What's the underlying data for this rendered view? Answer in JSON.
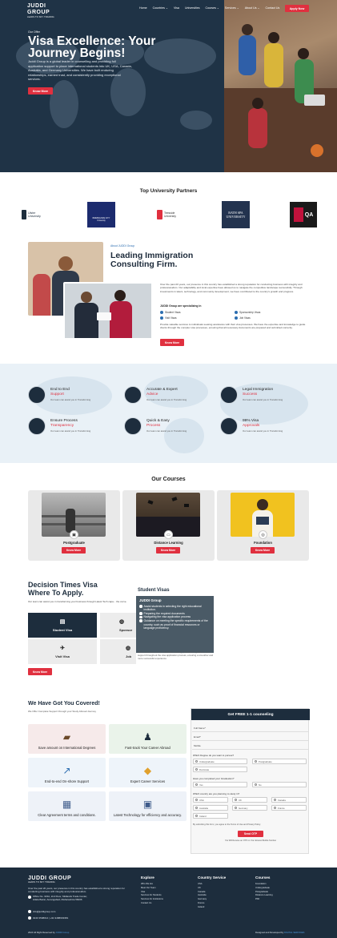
{
  "brand": {
    "name": "JUDDI GROUP",
    "tagline": "LEADS TO SKY TRADING"
  },
  "nav": {
    "items": [
      "Home",
      "Countries",
      "Visa",
      "Universities",
      "Courses",
      "Services",
      "About Us",
      "Contact Us"
    ],
    "apply_label": "Apply Now"
  },
  "hero": {
    "eyebrow": "Our Offer",
    "title": "Visa Excellence: Your Journey Begins!",
    "description": "Juddi Group is a global leader in counselling and providing full application support to place international students into UK, USA, Canada, Australia, and Germany Universities. We have built enduring relationships, earned trust, and consistently providing exceptional services.",
    "button": "Know More"
  },
  "partners": {
    "title": "Top University Partners",
    "logos": [
      {
        "name": "Ulster University",
        "color": "#1d2d3d"
      },
      {
        "name": "BIRMINGHAM CITY University",
        "color": "#1c2b6e"
      },
      {
        "name": "Teesside University",
        "color": "#e0303f"
      },
      {
        "name": "BATH SPA UNIVERSITY",
        "color": "#23334f"
      },
      {
        "name": "QA",
        "color": "#c0123c"
      }
    ]
  },
  "about": {
    "eyebrow": "About JUDDI Group",
    "title": "Leading Immigration Consulting Firm.",
    "p1": "Over the past 20 years, our presence in this country has established a strong reputation for conducting business with integrity and professionalism. Our adaptability and local expertise have allowed us to navigate the competitive landscape successfully. Through investments in talent, technology, and community development, we have contributed to the country's growth and progress.",
    "specializing": "JUDDI Group are specializing in",
    "checks": [
      "Student Visas",
      "Sponsorship Visas",
      "Visit Visas",
      "Job Visas"
    ],
    "p2": "Provide valuable services to individuals seeking assistance with their visa processes. We have the expertise and knowledge to guide clients through the complex visa processes, ensuring that all necessary documents are prepared and submitted correctly.",
    "button": "Know More"
  },
  "features": [
    {
      "t1": "End to End",
      "t2": "Support",
      "t3": "Our team can assist you in Transforming"
    },
    {
      "t1": "Accurate & Expert",
      "t2": "Advice",
      "t3": "Our team can assist you in Transforming"
    },
    {
      "t1": "Legal Immigration",
      "t2": "Success",
      "t3": "Our team can assist you in Transforming"
    },
    {
      "t1": "Ensure Process",
      "t2": "Transparency",
      "t3": "Our team can assist you in Transforming"
    },
    {
      "t1": "Quick & Easy",
      "t2": "Process",
      "t3": "Our team can assist you in Transforming"
    },
    {
      "t1": "99% Visa",
      "t2": "Approvals",
      "t3": "Our team can assist you in Transforming"
    }
  ],
  "courses": {
    "title": "Our Courses",
    "items": [
      {
        "name": "Postgraduate",
        "button": "Know More"
      },
      {
        "name": "Distance Learning",
        "button": "Know More"
      },
      {
        "name": "Foundation",
        "button": "Know More"
      }
    ]
  },
  "visa": {
    "title_accent": "Decision Times Visa",
    "title_rest": "Where To Apply.",
    "description": "Our team can assist you in transforming your business through Latest Tech capa... the curve.",
    "tiles": [
      "Student Visa",
      "Sponsor",
      "Visit Visa",
      "Job"
    ],
    "panel_title": "Student Visas",
    "popup_title": "JUDDI Group",
    "popup_items": [
      "Assist students in selecting the right educational institution.",
      "Preparing the required documents",
      "Navigating the visa application process",
      "Guidance on meeting the specific requirements of the country, such as proof of financial resources or language proficiency."
    ],
    "panel_text": "Serve as a resource for individuals seeking professional guidance and support throughout the visa application process, ensuring a smoother and more successful experience.",
    "button": "Know More"
  },
  "covered": {
    "title": "We Have Got You Covered!",
    "subtitle": "We Offer Complete Support through your Study Abroad Journey",
    "items": [
      "Save amount on International Degrees",
      "Fast-track Your Career Abroad",
      "End-to-end On-shore Support",
      "Expert Career Services",
      "Clear Agreement terms and conditions.",
      "Latest Technology for efficiency and accuracy."
    ]
  },
  "form": {
    "title": "Get FREE 1-1 counseling",
    "fields": [
      "Full Name*",
      "Email*",
      "Mobile"
    ],
    "q1": "Which Degree do you want to pursue?",
    "q1_opts": [
      "Undergraduate",
      "Postgraduate",
      "Doctorate"
    ],
    "q2": "Have you completed your Graduation?",
    "q2_opts": [
      "Yes",
      "No"
    ],
    "q3": "Which country are you planning to study in?",
    "q3_opts": [
      "USA",
      "UK",
      "Canada",
      "Australia",
      "Germany",
      "France",
      "Ireland"
    ],
    "consent": "By submitting this form, you agree to the Terms of Use and Privacy Policy.",
    "button": "Send OTP",
    "note": "You Will Receive an OTP on Your Entered Mobile Number"
  },
  "footer": {
    "about": "Over the past 20 years, our presence in this country has established a strong reputation for conducting business with integrity and professionalism.",
    "address": "Office No. 323A, 2nd Floor, Midlands Trade Center, Hilala Bazar, Aurangabad, Maharashtra 56006",
    "email": "info@juddigroup.com",
    "phone": "0240 3508014 | +91 9488603381",
    "copyright": "2024 All Right Reserved by",
    "copyright_brand": "JUDDI Group",
    "credit": "Designed and Developed by",
    "credit_brand": "DIGITAL SERVICES",
    "cols": [
      {
        "title": "Explore",
        "links": [
          "Who We Are",
          "Meet Our Team",
          "Visa",
          "Services for Students",
          "Services for Institutions",
          "Contact Us"
        ]
      },
      {
        "title": "Country Service",
        "links": [
          "USA",
          "UK",
          "Canada",
          "Australia",
          "Germany",
          "France",
          "Ireland"
        ]
      },
      {
        "title": "Courses",
        "links": [
          "Foundation",
          "Undergraduate",
          "Postgraduate",
          "Distance Learning",
          "PhD"
        ]
      }
    ]
  },
  "colors": {
    "accent": "#e0303f",
    "navy": "#1d2d3d",
    "link": "#2b6db0"
  }
}
